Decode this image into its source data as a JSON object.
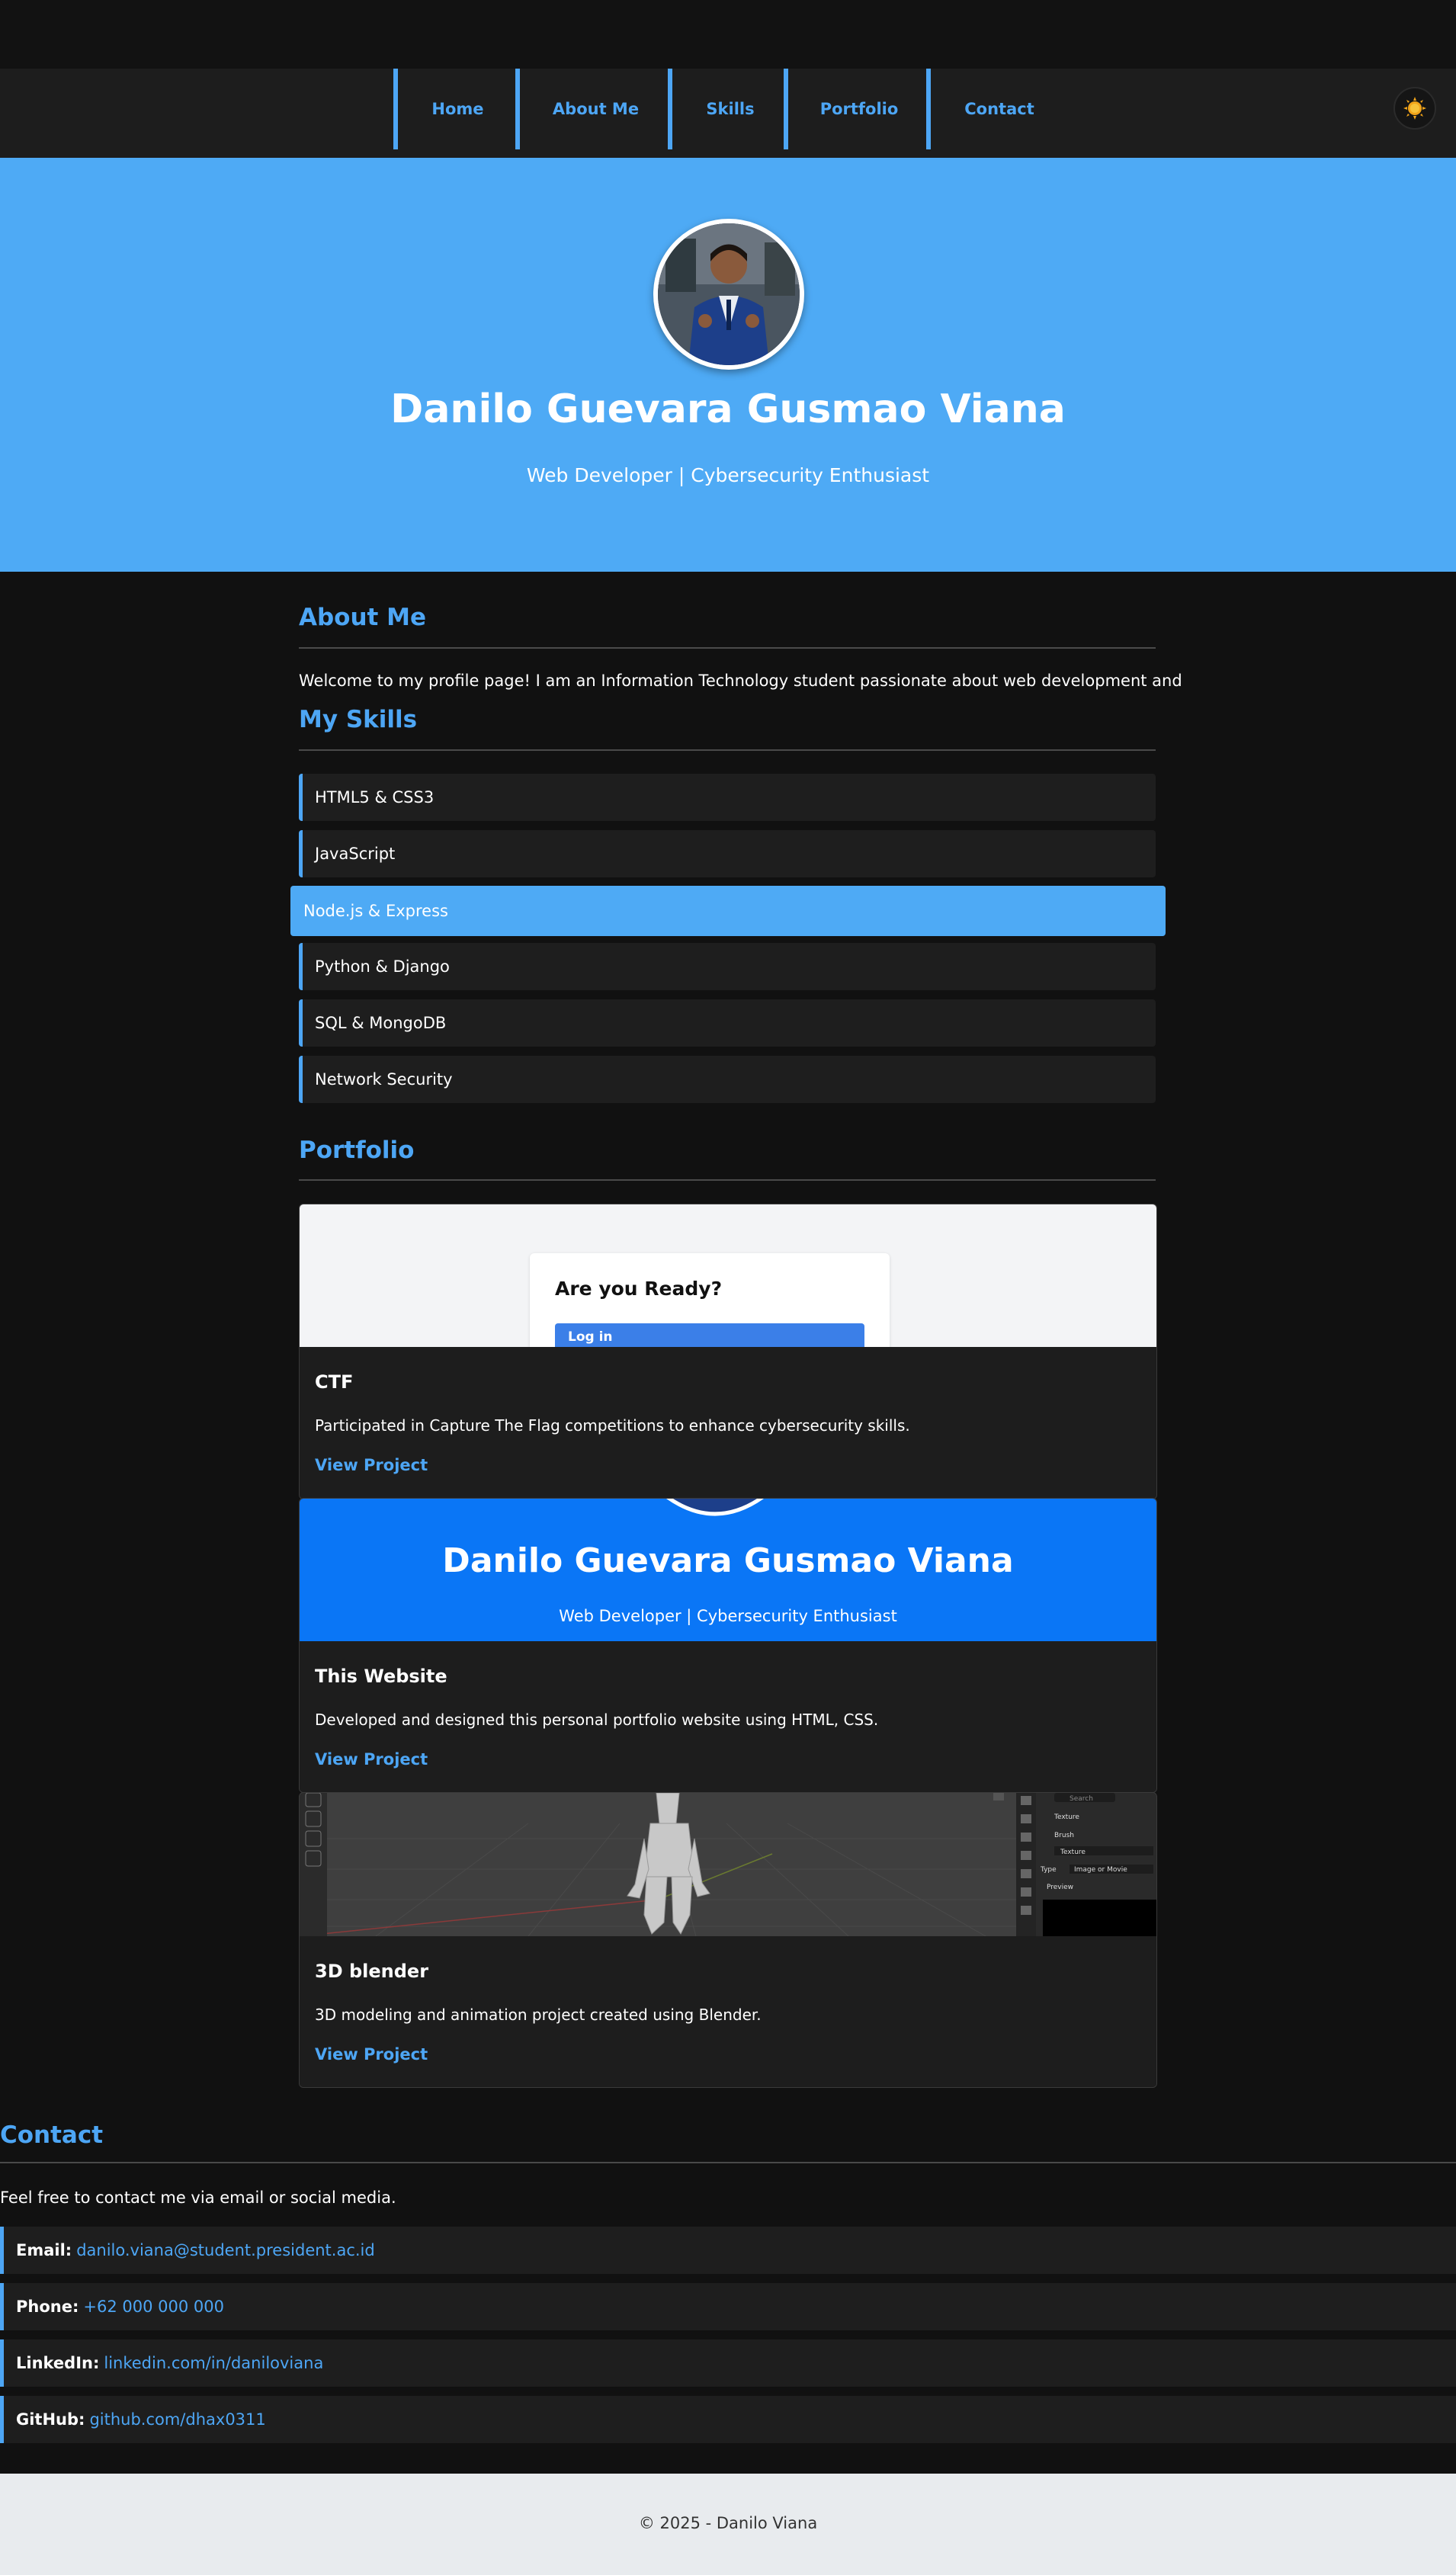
{
  "nav": {
    "items": [
      {
        "label": "Home"
      },
      {
        "label": "About Me"
      },
      {
        "label": "Skills"
      },
      {
        "label": "Portfolio"
      },
      {
        "label": "Contact"
      }
    ]
  },
  "hero": {
    "name": "Danilo Guevara Gusmao Viana",
    "tagline": "Web Developer | Cybersecurity Enthusiast"
  },
  "about": {
    "title": "About Me",
    "text": "Welcome to my profile page! I am an Information Technology student passionate about web development and"
  },
  "skills": {
    "title": "My Skills",
    "items": [
      "HTML5 & CSS3",
      "JavaScript",
      "Node.js & Express",
      "Python & Django",
      "SQL & MongoDB",
      "Network Security"
    ]
  },
  "portfolio": {
    "title": "Portfolio",
    "projects": [
      {
        "title": "CTF",
        "description": "Participated in Capture The Flag competitions to enhance cybersecurity skills.",
        "link": "View Project",
        "preview": {
          "heading": "Are you Ready?",
          "button": "Log in"
        }
      },
      {
        "title": "This Website",
        "description": "Developed and designed this personal portfolio website using HTML, CSS.",
        "link": "View Project",
        "preview": {
          "name": "Danilo Guevara Gusmao Viana",
          "tagline": "Web Developer | Cybersecurity Enthusiast"
        }
      },
      {
        "title": "3D blender",
        "description": "3D modeling and animation project created using Blender.",
        "link": "View Project",
        "preview": {
          "search": "Search",
          "texture": "Texture",
          "brush": "Brush",
          "texture2": "Texture",
          "type_label": "Type",
          "type_value": "Image or Movie",
          "preview_label": "Preview"
        }
      }
    ]
  },
  "contact": {
    "title": "Contact",
    "intro": "Feel free to contact me via email or social media.",
    "items": [
      {
        "label": "Email:",
        "value": "danilo.viana@student.president.ac.id"
      },
      {
        "label": "Phone:",
        "value": "+62 000 000 000"
      },
      {
        "label": "LinkedIn:",
        "value": "linkedin.com/in/daniloviana"
      },
      {
        "label": "GitHub:",
        "value": "github.com/dhax0311"
      }
    ]
  },
  "footer": {
    "text": "© 2025 - Danilo Viana"
  },
  "colors": {
    "accent": "#4da6f5",
    "hero_bg": "#4eaaf5",
    "page_bg": "#111111",
    "card_bg": "#1d1d1d",
    "preview_blue": "#0a76f6",
    "footer_bg": "#e8ebee"
  },
  "icons": {
    "theme_toggle": "sun-icon"
  }
}
